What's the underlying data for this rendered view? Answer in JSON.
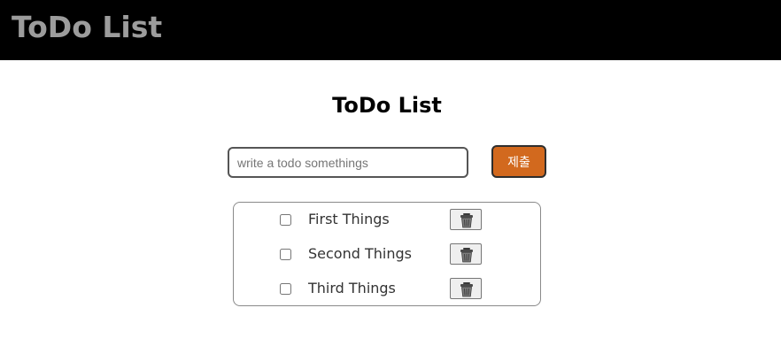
{
  "header": {
    "app_title": "ToDo List"
  },
  "main": {
    "title": "ToDo List",
    "input": {
      "value": "",
      "placeholder": "write a todo somethings"
    },
    "submit_label": "제출",
    "todos": [
      {
        "label": "First Things",
        "checked": false,
        "delete_icon": "trash-icon"
      },
      {
        "label": "Second Things",
        "checked": false,
        "delete_icon": "trash-icon"
      },
      {
        "label": "Third Things",
        "checked": false,
        "delete_icon": "trash-icon"
      }
    ]
  },
  "colors": {
    "header_bg": "#000000",
    "header_text": "#9c9c9c",
    "submit_bg": "#d2691e",
    "list_border": "#8a8a8a"
  }
}
